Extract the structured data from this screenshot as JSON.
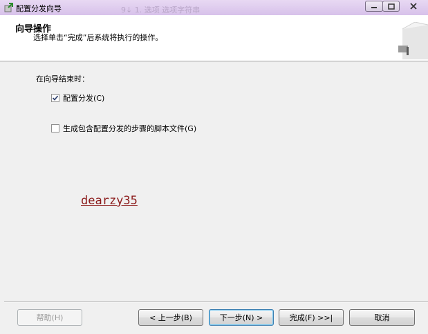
{
  "window": {
    "title": "配置分发向导",
    "bg_text": "9↓ 1. 选项  选项字符串"
  },
  "header": {
    "title": "向导操作",
    "subtitle": "选择单击“完成”后系统将执行的操作。"
  },
  "body": {
    "section_label": "在向导结束时：",
    "options": [
      {
        "label": "配置分发(C)",
        "checked": true
      },
      {
        "label": "生成包含配置分发的步骤的脚本文件(G)",
        "checked": false
      }
    ],
    "watermark": "dearzy35"
  },
  "buttons": {
    "help": "帮助(H)",
    "back": "< 上一步(B)",
    "next": "下一步(N) >",
    "finish": "完成(F) >>|",
    "cancel": "取消"
  },
  "colors": {
    "titlebar": "#d7c1ea",
    "watermark": "#8b1a1a",
    "default_button_border": "#3c7fb1"
  }
}
